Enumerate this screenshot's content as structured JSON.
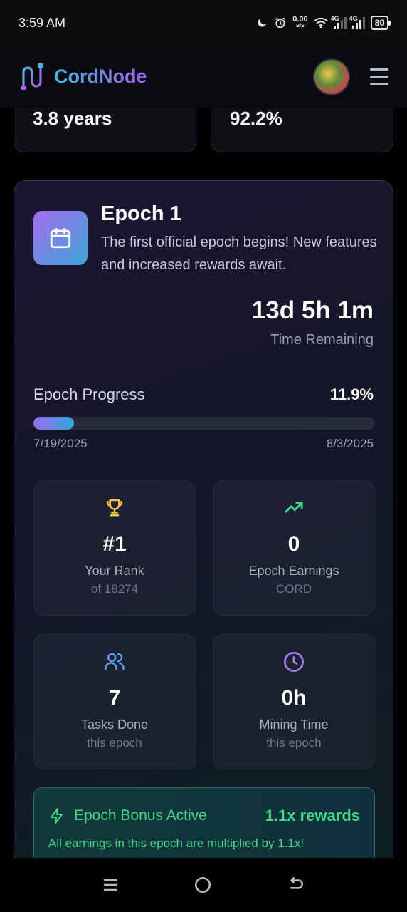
{
  "status": {
    "time": "3:59 AM",
    "net_speed": "0.00",
    "net_unit": "B/S",
    "sig1": "4G",
    "sig2": "4G",
    "battery": "80"
  },
  "header": {
    "brand": "CordNode"
  },
  "top_stats": {
    "left_value": "3.8 years",
    "right_value": "92.2%"
  },
  "epoch": {
    "title": "Epoch 1",
    "description": "The first official epoch begins! New features and increased rewards await.",
    "countdown": "13d 5h 1m",
    "countdown_label": "Time Remaining",
    "progress_label": "Epoch Progress",
    "progress_value": "11.9%",
    "progress_fraction": 0.119,
    "start_date": "7/19/2025",
    "end_date": "8/3/2025",
    "stats": [
      {
        "icon": "trophy-icon",
        "value": "#1",
        "label": "Your Rank",
        "sub": "of 18274",
        "color": "#f5c24a"
      },
      {
        "icon": "trending-up-icon",
        "value": "0",
        "label": "Epoch Earnings",
        "sub": "CORD",
        "color": "#3fd98a"
      },
      {
        "icon": "users-icon",
        "value": "7",
        "label": "Tasks Done",
        "sub": "this epoch",
        "color": "#5b9cf5"
      },
      {
        "icon": "clock-icon",
        "value": "0h",
        "label": "Mining Time",
        "sub": "this epoch",
        "color": "#b07cf2"
      }
    ],
    "bonus": {
      "title": "Epoch Bonus Active",
      "rate": "1.1x rewards",
      "message": "All earnings in this epoch are multiplied by 1.1x!",
      "color": "#3fd98a"
    }
  }
}
